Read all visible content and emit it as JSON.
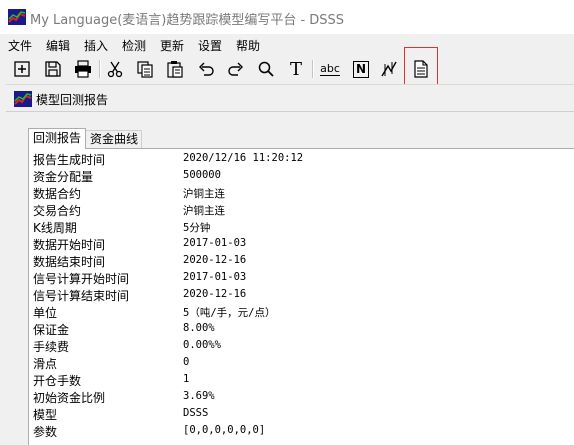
{
  "window": {
    "title": "My Language(麦语言)趋势跟踪模型编写平台 - DSSS",
    "accent": "#d02020"
  },
  "menu": [
    "文件",
    "编辑",
    "插入",
    "检测",
    "更新",
    "设置",
    "帮助"
  ],
  "toolbar": {
    "icons": [
      "new-icon",
      "save-icon",
      "print-icon",
      "cut-icon",
      "copy-icon",
      "paste-icon",
      "undo-icon",
      "redo-icon",
      "search-icon",
      "text-icon",
      "abc-icon",
      "n-icon",
      "chart-tool-icon",
      "report-icon"
    ],
    "text_label": "T",
    "abc_label": "abc",
    "n_label": "N"
  },
  "subwindow": {
    "title": "模型回测报告"
  },
  "tabs": [
    {
      "label": "回测报告",
      "active": true
    },
    {
      "label": "资金曲线",
      "active": false
    }
  ],
  "report": [
    {
      "label": "报告生成时间",
      "value": "2020/12/16 11:20:12"
    },
    {
      "label": "资金分配量",
      "value": "500000"
    },
    {
      "label": "数据合约",
      "value": "沪铜主连"
    },
    {
      "label": "交易合约",
      "value": "沪铜主连"
    },
    {
      "label": "K线周期",
      "value": "5分钟"
    },
    {
      "label": "数据开始时间",
      "value": "2017-01-03"
    },
    {
      "label": "数据结束时间",
      "value": "2020-12-16"
    },
    {
      "label": "信号计算开始时间",
      "value": "2017-01-03"
    },
    {
      "label": "信号计算结束时间",
      "value": "2020-12-16"
    },
    {
      "label": "单位",
      "value": "5（吨/手，元/点）"
    },
    {
      "label": "保证金",
      "value": "8.00%"
    },
    {
      "label": "手续费",
      "value": "0.00%%"
    },
    {
      "label": "滑点",
      "value": "0"
    },
    {
      "label": "开仓手数",
      "value": "1"
    },
    {
      "label": "初始资金比例",
      "value": "3.69%"
    },
    {
      "label": "模型",
      "value": "DSSS"
    },
    {
      "label": "参数",
      "value": "[0,0,0,0,0,0]"
    }
  ]
}
